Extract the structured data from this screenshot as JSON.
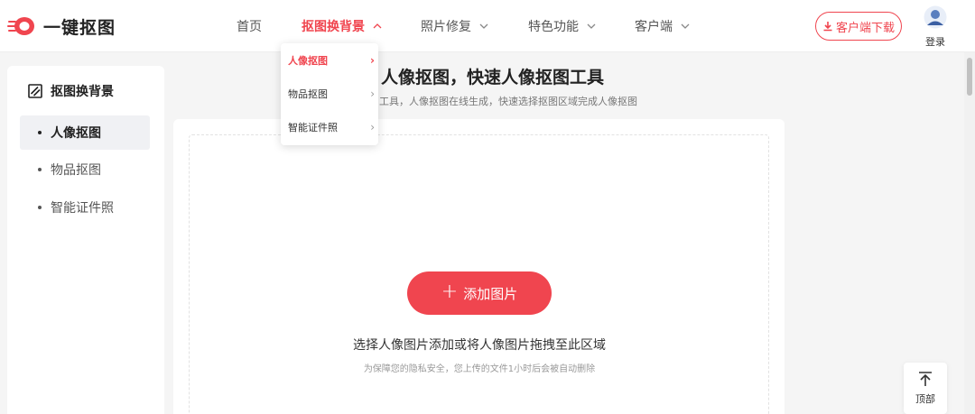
{
  "brand": {
    "name": "一键抠图",
    "accent_color": "#f0454f"
  },
  "nav": {
    "items": [
      {
        "label": "首页",
        "active": false,
        "has_dropdown": false
      },
      {
        "label": "抠图换背景",
        "active": true,
        "has_dropdown": true
      },
      {
        "label": "照片修复",
        "active": false,
        "has_dropdown": true
      },
      {
        "label": "特色功能",
        "active": false,
        "has_dropdown": true
      },
      {
        "label": "客户端",
        "active": false,
        "has_dropdown": true
      }
    ],
    "download_label": "客户端下载",
    "login_label": "登录"
  },
  "dropdown": {
    "items": [
      {
        "label": "人像抠图",
        "active": true
      },
      {
        "label": "物品抠图",
        "active": false
      },
      {
        "label": "智能证件照",
        "active": false
      }
    ]
  },
  "sidebar": {
    "title": "抠图换背景",
    "items": [
      {
        "label": "人像抠图",
        "active": true
      },
      {
        "label": "物品抠图",
        "active": false
      },
      {
        "label": "智能证件照",
        "active": false
      }
    ]
  },
  "main": {
    "title": "人像抠图，快速人像抠图工具",
    "subtitle": "工具，人像抠图在线生成，快速选择抠图区域完成人像抠图",
    "add_button": "添加图片",
    "hint": "选择人像图片添加或将人像图片拖拽至此区域",
    "note": "为保障您的隐私安全，您上传的文件1小时后会被自动删除"
  },
  "back_to_top": "顶部",
  "icons": {
    "logo": "logo-icon",
    "download": "download-icon",
    "avatar": "user-avatar-icon",
    "sidebar_head": "crop-icon",
    "plus": "plus-icon",
    "back_top": "arrow-up-icon",
    "chevron": "chevron-down-icon"
  }
}
